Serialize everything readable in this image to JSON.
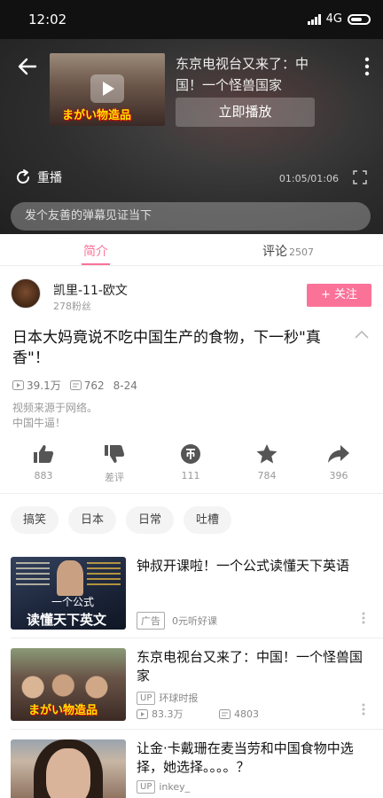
{
  "status_bar": {
    "time": "12:02",
    "network": "4G"
  },
  "player": {
    "next_title": "东京电视台又来了：中国！一个怪兽国家",
    "thumb_caption": "まがい物造品",
    "play_now": "立即播放",
    "replay": "重播",
    "time": "01:05/01:06",
    "danmaku_placeholder": "发个友善的弹幕见证当下"
  },
  "tabs": {
    "intro": "简介",
    "comments": "评论",
    "comments_count": "2507"
  },
  "uploader": {
    "name": "凯里-11-欧文",
    "fans": "278粉丝",
    "follow": "+ 关注"
  },
  "video": {
    "title": "日本大妈竟说不吃中国生产的食物，下一秒\"真香\"！",
    "views": "39.1万",
    "danmaku": "762",
    "date": "8-24",
    "desc_line1": "视频来源于网络。",
    "desc_line2": "中国牛逼！"
  },
  "actions": {
    "like": "883",
    "dislike": "差评",
    "coin": "111",
    "favorite": "784",
    "share": "396"
  },
  "tags": [
    "搞笑",
    "日本",
    "日常",
    "吐槽"
  ],
  "recommendations": [
    {
      "title": "钟叔开课啦！一个公式读懂天下英语",
      "badge": "广告",
      "sub": "0元听好课",
      "thumb_t1": "一个公式",
      "thumb_t2": "读懂天下英文"
    },
    {
      "title": "东京电视台又来了：中国！一个怪兽国家",
      "badge": "UP",
      "author": "环球时报",
      "views": "83.3万",
      "danmaku": "4803",
      "thumb_caption": "まがい物造品"
    },
    {
      "title": "让金·卡戴珊在麦当劳和中国食物中选择，她选择。。。。？",
      "badge": "UP",
      "author": "inkey_"
    }
  ],
  "colors": {
    "accent": "#fb7299",
    "action_icon": "#555555"
  }
}
